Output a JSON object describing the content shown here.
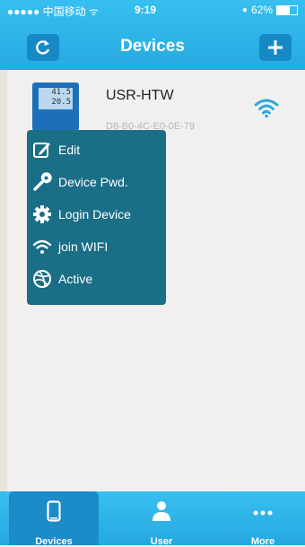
{
  "status_bar": {
    "carrier": "●●●●● 中国移动 ᯤ",
    "time": "9:19",
    "battery_percent": "62%",
    "battery_level": 0.62
  },
  "header": {
    "title": "Devices",
    "left_icon": "refresh-icon",
    "right_icon": "plus-icon"
  },
  "device": {
    "name": "USR-HTW",
    "mac": "D8-B0-4C-E0-0E-79",
    "screen_reading": "41.5",
    "screen_reading2": "20.5",
    "status_icon": "wifi-icon"
  },
  "context_menu": {
    "items": [
      {
        "label": "Edit",
        "icon": "edit-icon"
      },
      {
        "label": "Device Pwd.",
        "icon": "wrench-icon"
      },
      {
        "label": "Login Device",
        "icon": "gear-icon"
      },
      {
        "label": "join WIFI",
        "icon": "wifi-icon"
      },
      {
        "label": "Active",
        "icon": "dribbble-icon"
      }
    ]
  },
  "tab_bar": {
    "tabs": [
      {
        "label": "Devices",
        "icon": "phone-icon",
        "active": true
      },
      {
        "label": "User",
        "icon": "user-icon",
        "active": false
      },
      {
        "label": "More",
        "icon": "more-icon",
        "active": false
      }
    ]
  },
  "colors": {
    "header": "#2bb0e6",
    "menu_bg": "#1a6e86",
    "wifi": "#29a8de"
  }
}
